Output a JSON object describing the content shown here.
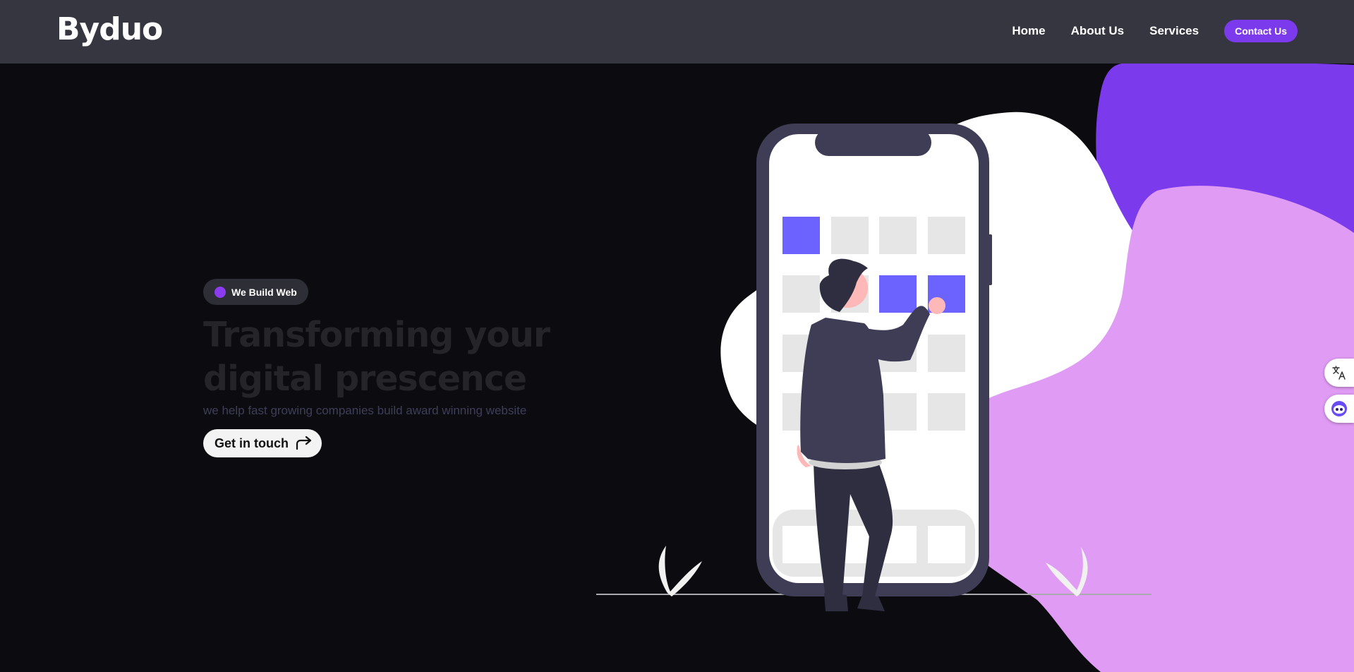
{
  "header": {
    "logo": "Byduo",
    "nav": {
      "home": "Home",
      "about": "About Us",
      "services": "Services",
      "contact": "Contact Us"
    }
  },
  "hero": {
    "badge": "We Build Web",
    "headline_line1": "Transforming your",
    "headline_line2": "digital prescence",
    "subtext": "we help fast growing companies build award winning website",
    "cta": "Get in touch"
  },
  "icons": {
    "cta_arrow": "share-arrow-icon",
    "translate": "translate-icon",
    "assistant": "assistant-icon"
  },
  "colors": {
    "page_bg": "#0b0b10",
    "header_bg": "#363640",
    "accent": "#7c3aed",
    "blob_purple": "#7c3aed",
    "blob_lavender": "#e09cf5",
    "phone_frame": "#3f3d56",
    "tile_active": "#6c63ff"
  }
}
